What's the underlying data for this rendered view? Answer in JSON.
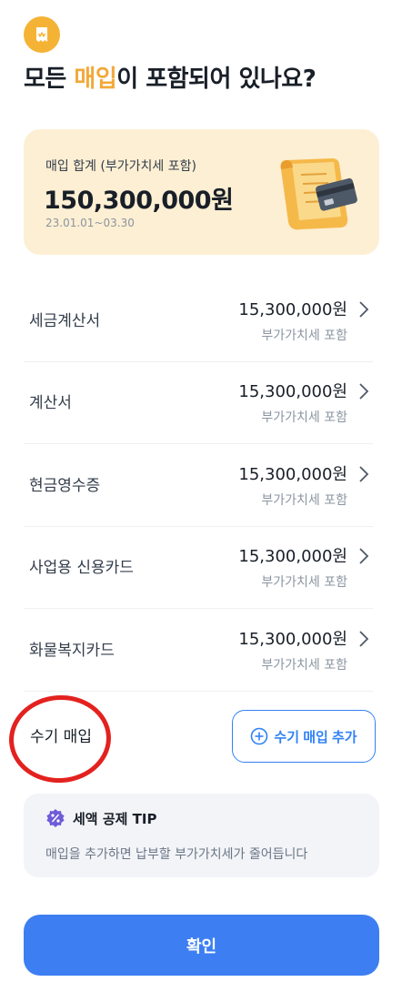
{
  "header": {
    "icon": "receipt-badge-icon",
    "title_prefix": "모든 ",
    "title_accent": "매입",
    "title_suffix": "이 포함되어 있나요?",
    "accent_color": "#f2a93b"
  },
  "summary": {
    "label": "매입 합계 (부가가치세 포함)",
    "amount": "150,300,000원",
    "period": "23.01.01~03.30",
    "illustration": "receipt-card-illustration"
  },
  "rows": [
    {
      "label": "세금계산서",
      "amount": "15,300,000원",
      "sub": "부가가치세 포함"
    },
    {
      "label": "계산서",
      "amount": "15,300,000원",
      "sub": "부가가치세 포함"
    },
    {
      "label": "현금영수증",
      "amount": "15,300,000원",
      "sub": "부가가치세 포함"
    },
    {
      "label": "사업용 신용카드",
      "amount": "15,300,000원",
      "sub": "부가가치세 포함"
    },
    {
      "label": "화물복지카드",
      "amount": "15,300,000원",
      "sub": "부가가치세 포함"
    }
  ],
  "manual": {
    "label": "수기 매입",
    "add_button_label": "수기 매입 추가"
  },
  "tip": {
    "title": "세액 공제 TIP",
    "body": "매입을 추가하면 납부할 부가가치세가 줄어듭니다"
  },
  "footer": {
    "confirm_label": "확인",
    "primary_color": "#3d7ff2"
  }
}
